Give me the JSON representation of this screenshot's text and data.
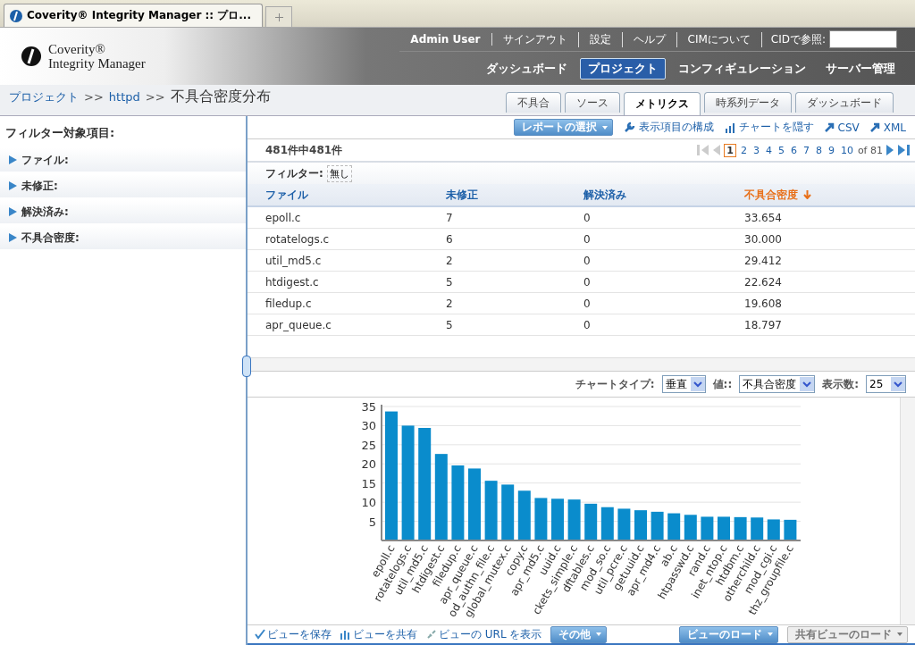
{
  "browser_tab": {
    "title": "Coverity® Integrity Manager :: プロ..."
  },
  "logo": {
    "line1": "Coverity®",
    "line2": "Integrity Manager"
  },
  "top_links": [
    {
      "label": "Admin User",
      "kind": "user"
    },
    {
      "label": "サインアウト",
      "kind": "link"
    },
    {
      "label": "設定",
      "kind": "link"
    },
    {
      "label": "ヘルプ",
      "kind": "link"
    },
    {
      "label": "CIMについて",
      "kind": "link"
    }
  ],
  "cid_search": {
    "label": "CIDで参照:"
  },
  "nav": [
    {
      "label": "ダッシュボード",
      "selected": false
    },
    {
      "label": "プロジェクト",
      "selected": true
    },
    {
      "label": "コンフィギュレーション",
      "selected": false
    },
    {
      "label": "サーバー管理",
      "selected": false
    }
  ],
  "breadcrumb": {
    "links": [
      "プロジェクト",
      "httpd"
    ],
    "separator": ">>",
    "current": "不具合密度分布"
  },
  "tabs": [
    {
      "label": "不具合",
      "selected": false
    },
    {
      "label": "ソース",
      "selected": false
    },
    {
      "label": "メトリクス",
      "selected": true
    },
    {
      "label": "時系列データ",
      "selected": false
    },
    {
      "label": "ダッシュボード",
      "selected": false
    }
  ],
  "sidebar": {
    "title": "フィルター対象項目:",
    "items": [
      {
        "label": "ファイル:",
        "expanded": false
      },
      {
        "label": "未修正:",
        "expanded": false
      },
      {
        "label": "解決済み:",
        "expanded": false
      },
      {
        "label": "不具合密度:",
        "expanded": false
      }
    ]
  },
  "toolbar": {
    "report_button": "レポートの選択",
    "actions": [
      {
        "label": "表示項目の構成",
        "kind": "wrench"
      },
      {
        "label": "チャートを隠す",
        "kind": "chart"
      },
      {
        "label": "CSV",
        "kind": "export"
      },
      {
        "label": "XML",
        "kind": "export"
      }
    ]
  },
  "count": "481件中481件",
  "pagination": {
    "pages": [
      {
        "label": "1",
        "selected": true
      },
      {
        "label": "2",
        "selected": false
      },
      {
        "label": "3",
        "selected": false
      },
      {
        "label": "4",
        "selected": false
      },
      {
        "label": "5",
        "selected": false
      },
      {
        "label": "6",
        "selected": false
      },
      {
        "label": "7",
        "selected": false
      },
      {
        "label": "8",
        "selected": false
      },
      {
        "label": "9",
        "selected": false
      },
      {
        "label": "10",
        "selected": false
      }
    ],
    "of": "of 81"
  },
  "filter": {
    "label": "フィルター:",
    "value": "無し"
  },
  "table": {
    "columns": [
      {
        "label": "ファイル",
        "sorted": false
      },
      {
        "label": "未修正",
        "sorted": false
      },
      {
        "label": "解決済み",
        "sorted": false
      },
      {
        "label": "不具合密度",
        "sorted": true
      }
    ],
    "rows": [
      [
        "epoll.c",
        "7",
        "0",
        "33.654"
      ],
      [
        "rotatelogs.c",
        "6",
        "0",
        "30.000"
      ],
      [
        "util_md5.c",
        "2",
        "0",
        "29.412"
      ],
      [
        "htdigest.c",
        "5",
        "0",
        "22.624"
      ],
      [
        "filedup.c",
        "2",
        "0",
        "19.608"
      ],
      [
        "apr_queue.c",
        "5",
        "0",
        "18.797"
      ]
    ]
  },
  "chart_controls": [
    {
      "label": "チャートタイプ:",
      "value": "垂直"
    },
    {
      "label": "値::",
      "value": "不具合密度"
    },
    {
      "label": "表示数:",
      "value": "25"
    }
  ],
  "chart_data": {
    "type": "bar",
    "orientation": "vertical",
    "categories": [
      "epoll.c",
      "rotatelogs.c",
      "util_md5.c",
      "htdigest.c",
      "filedup.c",
      "apr_queue.c",
      "od_authn_file.c",
      "global_mutex.c",
      "copy.c",
      "apr_md5.c",
      "uuid.c",
      "ckets_simple.c",
      "dftables.c",
      "mod_so.c",
      "util_pcre.c",
      "getuuid.c",
      "apr_md4.c",
      "ab.c",
      "htpasswd.c",
      "rand.c",
      "inet_ntop.c",
      "htdbm.c",
      "otherchild.c",
      "mod_cgi.c",
      "thz_groupfile.c"
    ],
    "series": [
      {
        "color": "#0a8ccc",
        "values": [
          33.7,
          30.0,
          29.4,
          22.6,
          19.6,
          18.8,
          15.6,
          14.6,
          13.0,
          11.1,
          10.9,
          10.7,
          9.6,
          8.7,
          8.3,
          7.9,
          7.5,
          7.1,
          6.7,
          6.2,
          6.2,
          6.1,
          6.0,
          5.5,
          5.4
        ]
      }
    ],
    "ylim": [
      0,
      35
    ],
    "yticks": [
      5,
      10,
      15,
      20,
      25,
      30,
      35
    ],
    "grid": true
  },
  "footer": {
    "links": [
      {
        "label": "ビューを保存",
        "kind": "check"
      },
      {
        "label": "ビューを共有",
        "kind": "bars"
      },
      {
        "label": "ビューの URL を表示",
        "kind": "link"
      }
    ],
    "more_button": "その他",
    "load_buttons": [
      {
        "label": "ビューのロード",
        "disabled": false
      },
      {
        "label": "共有ビューのロード",
        "disabled": true
      }
    ]
  }
}
